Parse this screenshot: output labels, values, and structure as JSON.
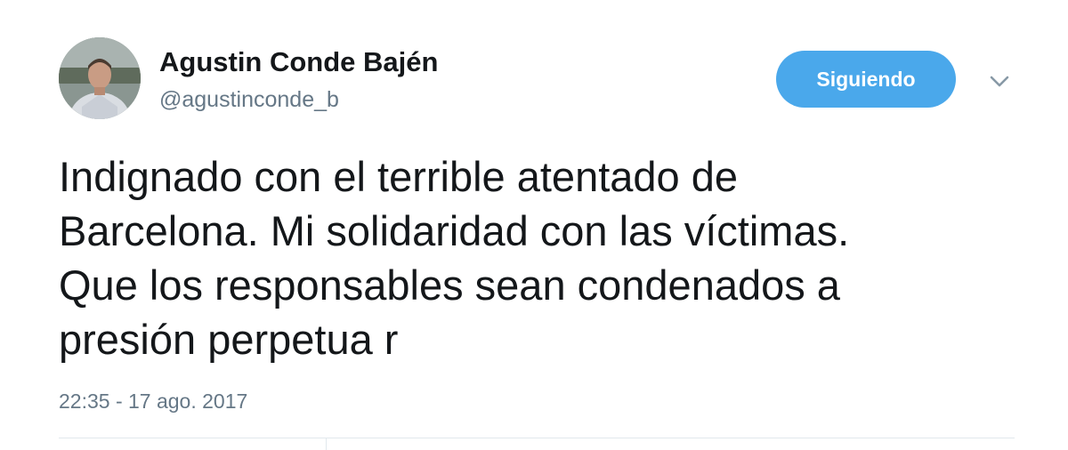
{
  "author": {
    "display_name": "Agustin Conde Bajén",
    "handle": "@agustinconde_b",
    "avatar_icon": "profile-photo"
  },
  "follow_button": {
    "label": "Siguiendo",
    "color": "#4aa8eb"
  },
  "menu_icon": "chevron-down-icon",
  "tweet": {
    "lines": [
      "Indignado con el terrible atentado de",
      "Barcelona. Mi solidaridad con las víctimas.",
      "Que los responsables sean condenados a",
      "presión perpetua r"
    ],
    "timestamp": "22:35 - 17 ago. 2017"
  }
}
